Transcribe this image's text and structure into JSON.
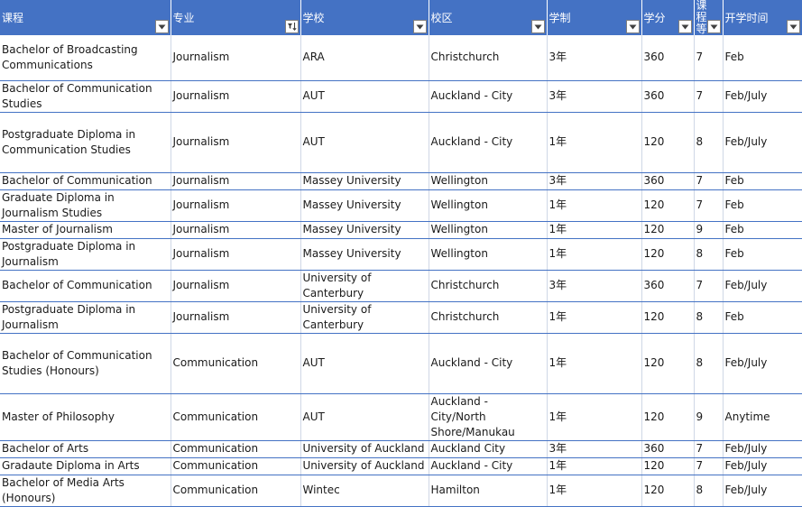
{
  "headers": [
    "课程",
    "专业",
    "学校",
    "校区",
    "学制",
    "学分",
    "课程等",
    "开学时间"
  ],
  "icons": {
    "dropdown": "dropdown-arrow-icon",
    "sorted_filter": "sort-filter-icon"
  },
  "colors": {
    "header_bg": "#4472c4",
    "row_border": "#4472c4"
  },
  "rows": [
    [
      "Bachelor of Broadcasting Communications",
      "Journalism",
      "ARA",
      "Christchurch",
      "3年",
      "360",
      "7",
      "Feb"
    ],
    [
      "Bachelor of Communication Studies",
      "Journalism",
      "AUT",
      "Auckland - City",
      "3年",
      "360",
      "7",
      "Feb/July"
    ],
    [
      "Postgraduate Diploma in Communication Studies",
      "Journalism",
      "AUT",
      "Auckland - City",
      "1年",
      "120",
      "8",
      "Feb/July"
    ],
    [
      "Bachelor of Communication",
      "Journalism",
      "Massey University",
      "Wellington",
      "3年",
      "360",
      "7",
      "Feb"
    ],
    [
      "Graduate Diploma in Journalism Studies",
      "Journalism",
      "Massey University",
      "Wellington",
      "1年",
      "120",
      "7",
      "Feb"
    ],
    [
      "Master of Journalism",
      "Journalism",
      "Massey University",
      "Wellington",
      "1年",
      "120",
      "9",
      "Feb"
    ],
    [
      "Postgraduate Diploma in Journalism",
      "Journalism",
      "Massey University",
      "Wellington",
      "1年",
      "120",
      "8",
      "Feb"
    ],
    [
      "Bachelor of Communication",
      "Journalism",
      "University of Canterbury",
      "Christchurch",
      "3年",
      "360",
      "7",
      "Feb/July"
    ],
    [
      "Postgraduate Diploma in Journalism",
      "Journalism",
      "University of Canterbury",
      "Christchurch",
      "1年",
      "120",
      "8",
      "Feb"
    ],
    [
      "Bachelor of Communication Studies (Honours)",
      "Communication",
      "AUT",
      "Auckland - City",
      "1年",
      "120",
      "8",
      "Feb/July"
    ],
    [
      "Master of Philosophy",
      "Communication",
      "AUT",
      "Auckland - City/North Shore/Manukau",
      "1年",
      "120",
      "9",
      "Anytime"
    ],
    [
      "Bachelor of Arts",
      "Communication",
      "University of Auckland",
      "Auckland City",
      "3年",
      "360",
      "7",
      "Feb/July"
    ],
    [
      "Gradaute Diploma in Arts",
      "Communication",
      "University of Auckland",
      "Auckland - City",
      "1年",
      "120",
      "7",
      "Feb/July"
    ],
    [
      "Bachelor of Media Arts (Honours)",
      "Communication",
      "Wintec",
      "Hamilton",
      "1年",
      "120",
      "8",
      "Feb/July"
    ]
  ]
}
